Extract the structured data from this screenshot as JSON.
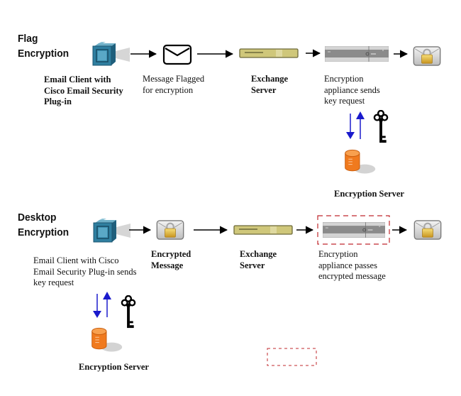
{
  "sections": [
    {
      "title_lines": [
        "Flag",
        "Encryption"
      ],
      "nodes": [
        {
          "icon": "email-client-icon",
          "label_lines": [
            "Email Client with",
            "Cisco Email Security",
            "Plug-in"
          ],
          "label_bold": true
        },
        {
          "icon": "envelope-icon",
          "label_lines": [
            "Message Flagged",
            "for encryption"
          ],
          "label_bold": false
        },
        {
          "icon": "exchange-server-icon",
          "label_lines": [
            "Exchange",
            "Server"
          ],
          "label_bold": true
        },
        {
          "icon": "encryption-appliance-icon",
          "label_lines": [
            "Encryption",
            "appliance sends",
            "key request"
          ],
          "label_bold": false
        },
        {
          "icon": "encrypted-envelope-icon",
          "label_lines": [],
          "label_bold": false
        }
      ],
      "key_server": {
        "label": "Encryption Server"
      }
    },
    {
      "title_lines": [
        "Desktop",
        "Encryption"
      ],
      "nodes": [
        {
          "icon": "email-client-icon",
          "label_lines": [
            "Email Client with Cisco",
            "Email Security Plug-in sends",
            "key request"
          ],
          "label_bold": false
        },
        {
          "icon": "encrypted-envelope-icon",
          "label_lines": [
            "Encrypted",
            "Message"
          ],
          "label_bold": true
        },
        {
          "icon": "exchange-server-icon",
          "label_lines": [
            "Exchange",
            "Server"
          ],
          "label_bold": true
        },
        {
          "icon": "encryption-appliance-icon",
          "label_lines": [
            "Encryption",
            "appliance passes",
            "encrypted message"
          ],
          "label_bold": false,
          "highlighted": true
        },
        {
          "icon": "encrypted-envelope-icon",
          "label_lines": [],
          "label_bold": false
        }
      ],
      "key_server": {
        "label": "Encryption Server"
      }
    }
  ],
  "legend": {
    "highlight_box": "dashed-red-box"
  },
  "colors": {
    "client_blue": "#2f7fa0",
    "exchange_gold": "#cfc77a",
    "appliance_gray": "#8a8a8a",
    "server_orange": "#f07a1e",
    "arrow_blue": "#1a1acc",
    "highlight_red": "#c0282d"
  }
}
